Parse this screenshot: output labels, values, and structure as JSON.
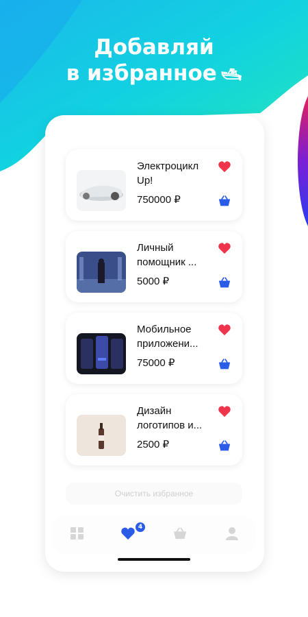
{
  "headline": {
    "line1": "Добавляй",
    "line2": "в избранное",
    "emoji": "🛥"
  },
  "items": [
    {
      "title": "Электроцикл Up!",
      "price": "750000 ₽",
      "thumb": "car-image"
    },
    {
      "title": "Личный помощник ...",
      "price": "5000 ₽",
      "thumb": "assistant-image"
    },
    {
      "title": "Мобильное приложени...",
      "price": "75000 ₽",
      "thumb": "app-image"
    },
    {
      "title": "Дизайн логотипов и...",
      "price": "2500 ₽",
      "thumb": "logo-design-image"
    }
  ],
  "clear_button": "Очистить избранное",
  "tabbar": {
    "tabs": [
      "catalog-icon",
      "favorites-icon",
      "basket-icon",
      "profile-icon"
    ],
    "favorites_badge": "4"
  },
  "colors": {
    "accent": "#2a5ce8",
    "heart": "#f0344b",
    "blob_start": "#14c5e8",
    "blob_end": "#1fe3b8"
  }
}
